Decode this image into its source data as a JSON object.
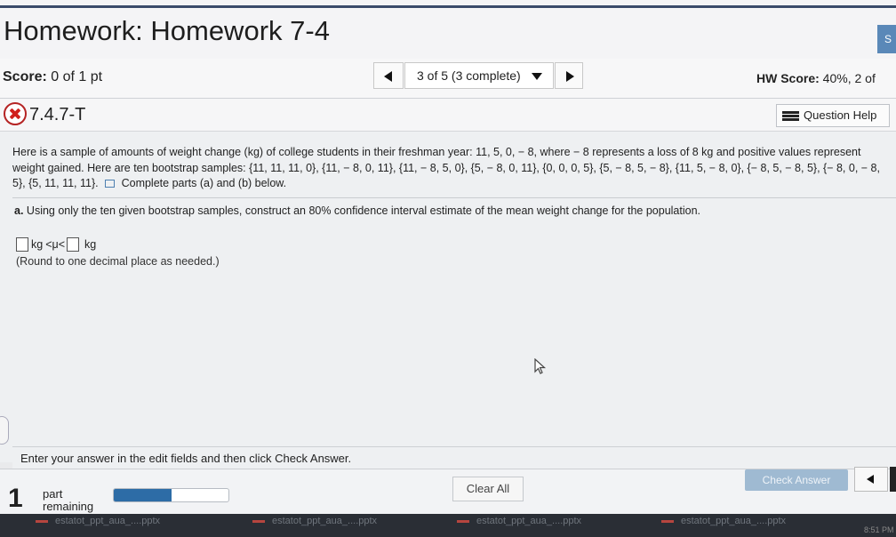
{
  "header": {
    "title": "Homework: Homework 7-4",
    "corner_button": "S"
  },
  "scorebar": {
    "score_label": "Score:",
    "score_value": " 0 of 1 pt",
    "question_selector": "3 of 5 (3 complete)",
    "hw_score_label": "HW Score:",
    "hw_score_value": " 40%, 2 of"
  },
  "question": {
    "number": "7.4.7-T",
    "help_label": "Question Help",
    "problem_text_1": "Here is a sample of amounts of weight change (kg) of college students in their freshman year: 11, 5, 0, − 8, where − 8 represents a loss of 8 kg and positive values represent weight gained. Here are ten bootstrap samples: {11, 11, 11, 0}, {11, − 8, 0, 11}, {11, − 8, 5, 0}, {5, − 8, 0, 11}, {0, 0, 0, 5}, {5, − 8, 5, − 8}, {11, 5, − 8, 0}, {− 8, 5, − 8, 5}, {− 8, 0, − 8, 5}, {5, 11, 11, 11}.",
    "problem_text_2": "Complete parts (a) and (b) below.",
    "part_a_label": "a.",
    "part_a_text": " Using only the ten given bootstrap samples, construct an 80% confidence interval estimate of the mean weight change for the population.",
    "answer_unit_1": "kg",
    "answer_mid": "<μ<",
    "answer_unit_2": "kg",
    "round_note": "(Round to one decimal place as needed.)",
    "instruction": "Enter your answer in the edit fields and then click Check Answer."
  },
  "footer": {
    "parts_count": "1",
    "parts_line1": "part",
    "parts_line2": "remaining",
    "progress_fraction": 0.5,
    "clear_all": "Clear All",
    "check_answer": "Check Answer"
  },
  "taskbar": {
    "items": [
      "estatot_ppt_aua_....pptx",
      "estatot_ppt_aua_....pptx",
      "estatot_ppt_aua_....pptx",
      "estatot_ppt_aua_....pptx"
    ],
    "clock": "8:51 PM"
  },
  "colors": {
    "accent": "#2d6ca6",
    "incorrect": "#d0201c",
    "check_button": "#9fbad2"
  }
}
